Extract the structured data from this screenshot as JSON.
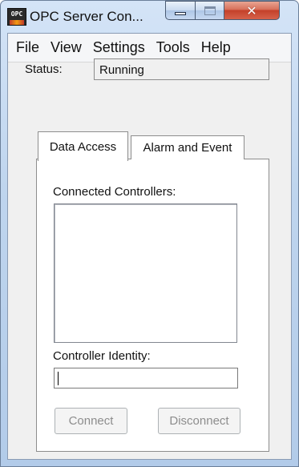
{
  "window": {
    "title": "OPC Server Con...",
    "app_icon_text": "OPC"
  },
  "menu": {
    "items": [
      "File",
      "View",
      "Settings",
      "Tools",
      "Help"
    ]
  },
  "status": {
    "label": "Status:",
    "value": "Running"
  },
  "tabs": [
    {
      "label": "Data Access",
      "selected": true
    },
    {
      "label": "Alarm and Event",
      "selected": false
    }
  ],
  "data_access": {
    "connected_controllers_label": "Connected Controllers:",
    "controller_identity_label": "Controller Identity:",
    "controller_identity_value": "",
    "connect_label": "Connect",
    "disconnect_label": "Disconnect"
  }
}
